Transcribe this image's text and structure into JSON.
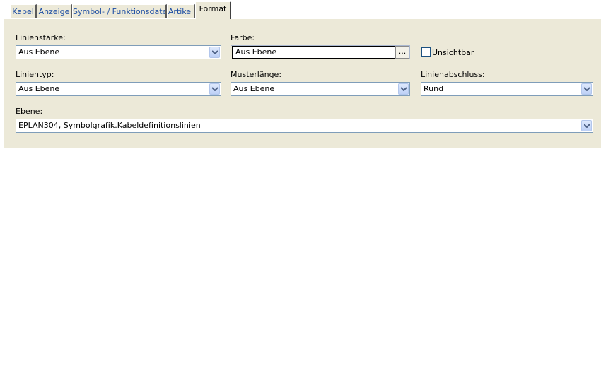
{
  "tabs": [
    {
      "label": "Kabel"
    },
    {
      "label": "Anzeige"
    },
    {
      "label": "Symbol- / Funktionsdaten"
    },
    {
      "label": "Artikel"
    },
    {
      "label": "Format"
    }
  ],
  "active_tab": "Format",
  "form": {
    "linienstaerke": {
      "label": "Linienstärke:",
      "value": "Aus Ebene"
    },
    "farbe": {
      "label": "Farbe:",
      "value": "Aus Ebene",
      "button_label": "..."
    },
    "unsichtbar": {
      "label": "Unsichtbar",
      "checked": false
    },
    "linientyp": {
      "label": "Linientyp:",
      "value": "Aus Ebene"
    },
    "musterlaenge": {
      "label": "Musterlänge:",
      "value": "Aus Ebene"
    },
    "linienabschluss": {
      "label": "Linienabschluss:",
      "value": "Rund"
    },
    "ebene": {
      "label": "Ebene:",
      "value": "EPLAN304, Symbolgrafik.Kabeldefinitionslinien"
    }
  },
  "colors": {
    "panel_bg": "#ece9d8",
    "tab_text": "#1f4fa3",
    "field_border": "#7f9db9"
  }
}
